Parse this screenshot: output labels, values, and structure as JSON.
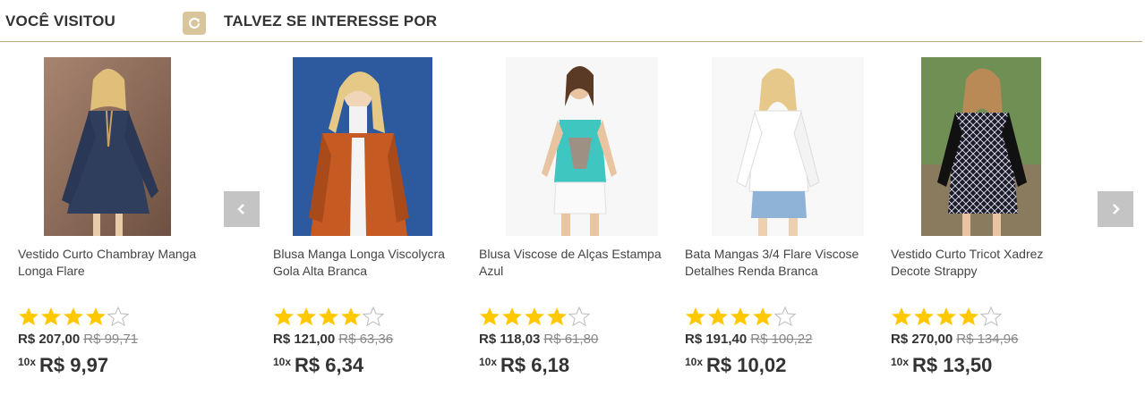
{
  "header": {
    "visited_title": "VOCÊ VISITOU",
    "suggest_title": "TALVEZ SE INTERESSE POR"
  },
  "colors": {
    "accent": "#d8c59b",
    "divider": "#b9a982",
    "star": "#ffc800",
    "arrow_bg": "#c4c4c4"
  },
  "products": [
    {
      "name": "Vestido Curto Chambray Manga Longa Flare",
      "rating": 4,
      "price": "R$ 207,00",
      "old_price": "R$ 99,71",
      "installments": "10x",
      "installment_value": "R$ 9,97"
    },
    {
      "name": "Blusa Manga Longa Viscolycra Gola Alta Branca",
      "rating": 4,
      "price": "R$ 121,00",
      "old_price": "R$ 63,36",
      "installments": "10x",
      "installment_value": "R$ 6,34"
    },
    {
      "name": "Blusa Viscose de Alças Estampa Azul",
      "rating": 4,
      "price": "R$ 118,03",
      "old_price": "R$ 61,80",
      "installments": "10x",
      "installment_value": "R$ 6,18"
    },
    {
      "name": "Bata Mangas 3/4 Flare Viscose Detalhes Renda Branca",
      "rating": 4,
      "price": "R$ 191,40",
      "old_price": "R$ 100,22",
      "installments": "10x",
      "installment_value": "R$ 10,02"
    },
    {
      "name": "Vestido Curto Tricot Xadrez Decote Strappy",
      "rating": 4,
      "price": "R$ 270,00",
      "old_price": "R$ 134,96",
      "installments": "10x",
      "installment_value": "R$ 13,50"
    }
  ]
}
